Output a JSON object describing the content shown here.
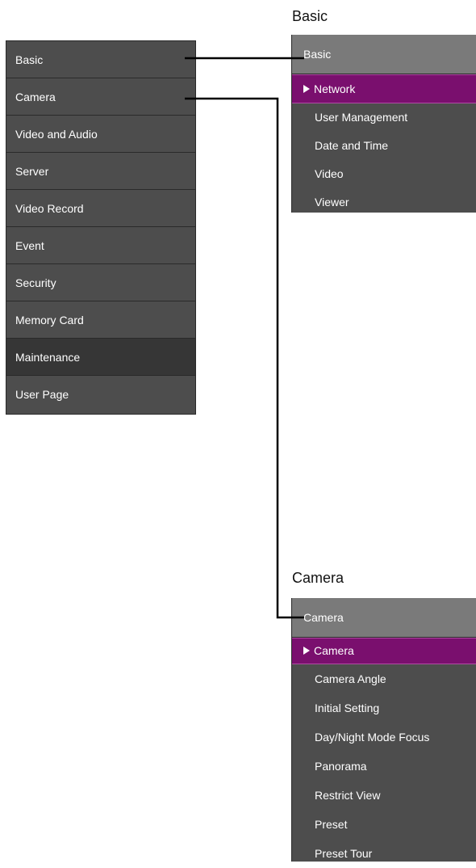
{
  "main_menu": {
    "items": [
      "Basic",
      "Camera",
      "Video and Audio",
      "Server",
      "Video Record",
      "Event",
      "Security",
      "Memory Card",
      "Maintenance",
      "User Page"
    ]
  },
  "basic_panel": {
    "caption": "Basic",
    "header": "Basic",
    "items": [
      "Network",
      "User Management",
      "Date and Time",
      "Video",
      "Viewer"
    ]
  },
  "camera_panel": {
    "caption": "Camera",
    "header": "Camera",
    "items": [
      "Camera",
      "Camera Angle",
      "Initial Setting",
      "Day/Night Mode Focus",
      "Panorama",
      "Restrict View",
      "Preset",
      "Preset Tour"
    ]
  },
  "colors": {
    "menu_bg": "#4d4d4d",
    "menu_dark": "#363636",
    "header_bg": "#7a7a7a",
    "active_bg": "#7a0f6e"
  }
}
